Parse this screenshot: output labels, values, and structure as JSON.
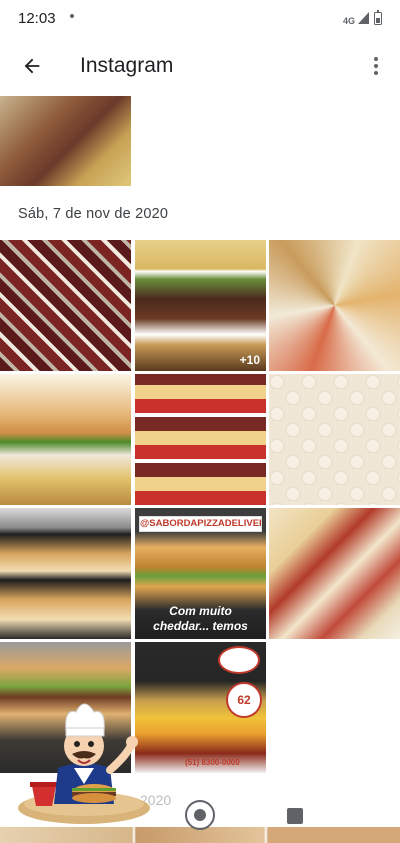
{
  "status_bar": {
    "time": "12:03",
    "network": "4G"
  },
  "app_bar": {
    "title": "Instagram",
    "back_icon": "arrow-back-icon",
    "more_icon": "more-vert-icon"
  },
  "sections": [
    {
      "date": "Sáb, 7 de nov de 2020"
    }
  ],
  "photos": {
    "t2_overlay": "+10",
    "t8_handle": "@SABORDAPIZZADELIVERY",
    "t8_caption_line1": "Com muito",
    "t8_caption_line2": "cheddar... temos",
    "t11_price": "62",
    "t11_phone": "(51) 8300-0000"
  },
  "faded_date": "2020",
  "nav": {
    "home_icon": "home-circle-icon",
    "recents_icon": "recents-square-icon"
  },
  "colors": {
    "icon_gray": "#5f6368",
    "text_primary": "#202124",
    "accent_red": "#c0392b"
  }
}
